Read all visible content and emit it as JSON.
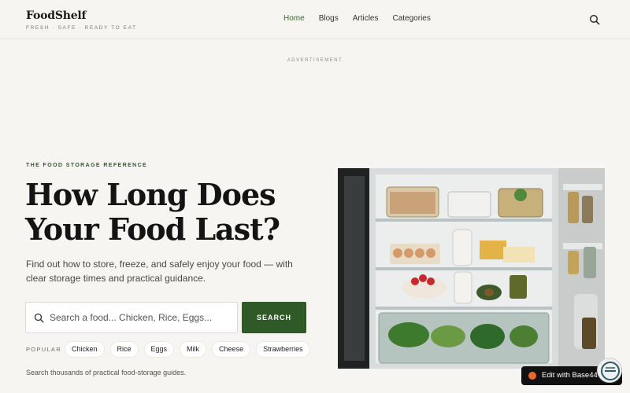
{
  "brand": {
    "name": "FoodShelf",
    "tagline": "FRESH · SAFE · READY TO EAT"
  },
  "nav": {
    "items": [
      {
        "label": "Home",
        "active": true
      },
      {
        "label": "Blogs",
        "active": false
      },
      {
        "label": "Articles",
        "active": false
      },
      {
        "label": "Categories",
        "active": false
      }
    ],
    "search_icon": "search-icon"
  },
  "ad": {
    "label": "ADVERTISEMENT"
  },
  "hero": {
    "eyebrow": "THE FOOD STORAGE REFERENCE",
    "title": "How Long Does Your Food Last?",
    "subtitle": "Find out how to store, freeze, and safely enjoy your food — with clear storage times and practical guidance.",
    "search_placeholder": "Search a food... Chicken, Rice, Eggs...",
    "search_value": "",
    "search_button": "SEARCH",
    "popular_label": "POPULAR",
    "popular": [
      "Chicken",
      "Rice",
      "Eggs",
      "Milk",
      "Cheese",
      "Strawberries"
    ],
    "footnote": "Search thousands of practical food-storage guides."
  },
  "badge": {
    "edit_label": "Edit with Base44"
  },
  "colors": {
    "accent": "#2f5a27",
    "nav_active": "#2f6b2c",
    "background": "#f6f5f2"
  }
}
